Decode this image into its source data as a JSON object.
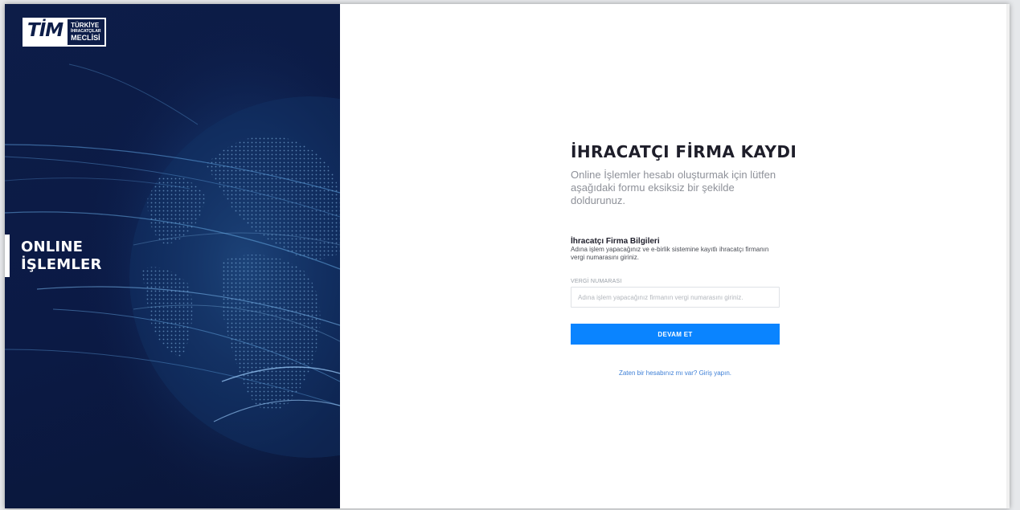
{
  "brand": {
    "logo_mark": "TİM",
    "logo_line1": "TÜRKİYE",
    "logo_line2": "İHRACATÇILAR",
    "logo_line3": "MECLİSİ"
  },
  "hero": {
    "title_line1": "ONLINE",
    "title_line2": "İŞLEMLER"
  },
  "form": {
    "title": "İHRACATÇI FİRMA KAYDI",
    "subtitle": "Online İşlemler hesabı oluşturmak için lütfen aşağıdaki formu eksiksiz bir şekilde doldurunuz.",
    "section_title": "İhracatçı Firma Bilgileri",
    "section_desc": "Adına işlem yapacağınız ve e-birlik sistemine kayıtlı ihracatçı firmanın vergi numarasını giriniz.",
    "tax_label": "VERGİ NUMARASI",
    "tax_placeholder": "Adına işlem yapacağınız firmanın vergi numarasını giriniz.",
    "tax_value": "",
    "submit_label": "DEVAM ET",
    "login_link": "Zaten bir hesabınız mı var? Giriş yapın."
  },
  "colors": {
    "hero_bg": "#0d1d48",
    "primary_button": "#0a84ff",
    "link": "#3d7fd6",
    "title": "#1e1e2a"
  }
}
